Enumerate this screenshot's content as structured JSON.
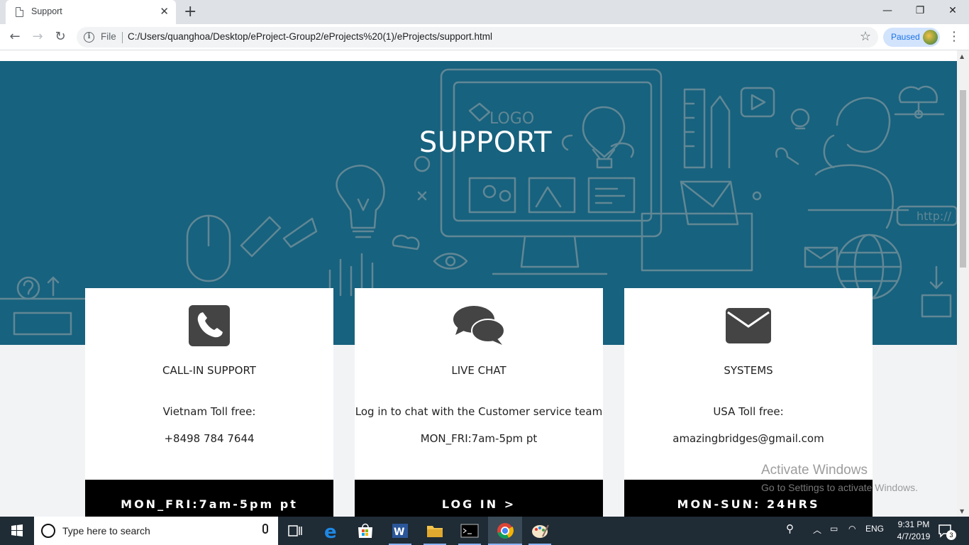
{
  "browser": {
    "tab_title": "Support",
    "new_tab": "+",
    "address_scheme": "File",
    "address_url": "C:/Users/quanghoa/Desktop/eProject-Group2/eProjects%20(1)/eProjects/support.html",
    "profile_status": "Paused",
    "window_controls": {
      "minimize": "—",
      "restore": "❐",
      "close": "✕"
    }
  },
  "page": {
    "hero_title": "SUPPORT",
    "hero_color": "#17627e",
    "cards": [
      {
        "icon": "phone-icon",
        "heading": "CALL-IN SUPPORT",
        "line1": "Vietnam Toll free:",
        "line2": "+8498 784 7644",
        "cta": "MON_FRI:7am-5pm pt"
      },
      {
        "icon": "chat-icon",
        "heading": "LIVE CHAT",
        "line1": "Log in to chat with the Customer service team",
        "line2": "MON_FRI:7am-5pm pt",
        "cta": "LOG IN >"
      },
      {
        "icon": "envelope-icon",
        "heading": "SYSTEMS",
        "line1": "USA Toll free:",
        "line2": "amazingbridges@gmail.com",
        "cta": "MON-SUN: 24HRS"
      }
    ]
  },
  "watermark": {
    "line1": "Activate Windows",
    "line2": "Go to Settings to activate Windows."
  },
  "taskbar": {
    "search_placeholder": "Type here to search",
    "language": "ENG",
    "time": "9:31 PM",
    "date": "4/7/2019",
    "notification_count": "3"
  }
}
